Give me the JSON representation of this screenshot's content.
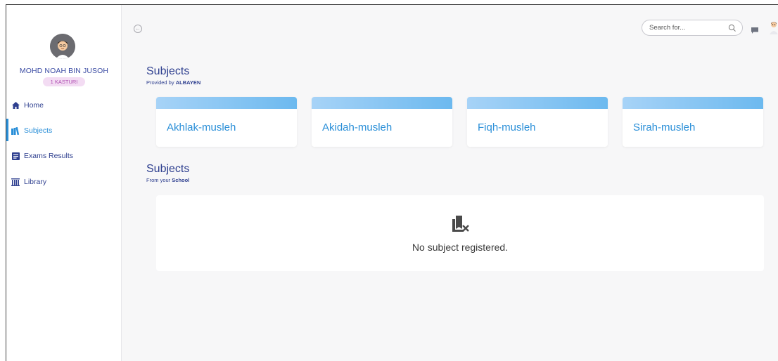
{
  "user": {
    "name": "MOHD NOAH BIN JUSOH",
    "class_badge": "1 KASTURI"
  },
  "sidebar": {
    "items": [
      {
        "label": "Home",
        "icon": "home-icon"
      },
      {
        "label": "Subjects",
        "icon": "books-icon",
        "active": true
      },
      {
        "label": "Exams Results",
        "icon": "document-icon"
      },
      {
        "label": "Library",
        "icon": "library-icon"
      }
    ]
  },
  "topbar": {
    "search_placeholder": "Search for..."
  },
  "provided_section": {
    "title": "Subjects",
    "subtitle_prefix": "Provided by ",
    "subtitle_bold": "ALBAYEN"
  },
  "subjects": [
    {
      "label": "Akhlak-musleh"
    },
    {
      "label": "Akidah-musleh"
    },
    {
      "label": "Fiqh-musleh"
    },
    {
      "label": "Sirah-musleh"
    }
  ],
  "school_section": {
    "title": "Subjects",
    "subtitle_prefix": "From your ",
    "subtitle_bold": "School",
    "empty_text": "No subject registered."
  },
  "colors": {
    "primary_text": "#2e3f8f",
    "accent": "#2a8fd8",
    "card_bar_start": "#a7d3f7",
    "card_bar_end": "#6cb9ef",
    "badge_bg": "#f3dcf3",
    "badge_text": "#b04fb3"
  }
}
